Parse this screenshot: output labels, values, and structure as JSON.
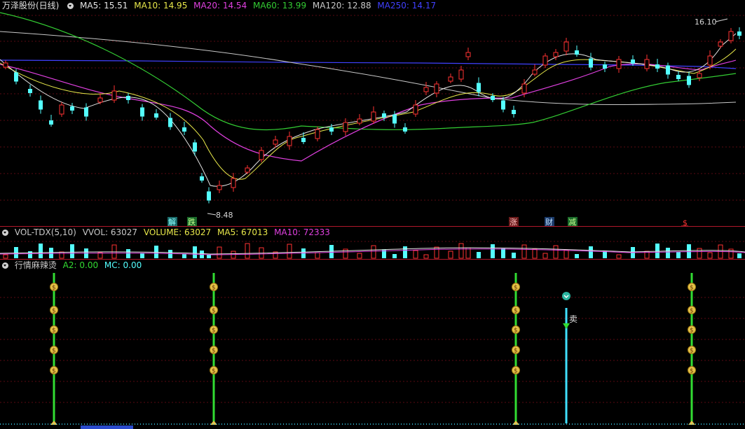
{
  "main": {
    "stock_name": "万泽股份(日线)",
    "ma": [
      {
        "label": "MA5: 15.51",
        "color": "#e6e6e6"
      },
      {
        "label": "MA10: 14.95",
        "color": "#e8e84a"
      },
      {
        "label": "MA20: 14.54",
        "color": "#e040e0"
      },
      {
        "label": "MA60: 13.99",
        "color": "#33cc33"
      },
      {
        "label": "MA120: 12.88",
        "color": "#c8c8c8"
      },
      {
        "label": "MA250: 14.17",
        "color": "#4040ff"
      }
    ],
    "high_label": "16.10",
    "low_label": "8.48",
    "events": [
      "解",
      "跌",
      "涨",
      "财",
      "减",
      "$"
    ]
  },
  "volume": {
    "title": "VOL-TDX(5,10)",
    "vvol": "VVOL: 63027",
    "volume": "VOLUME: 63027",
    "ma5": "MA5: 67013",
    "ma10": "MA10: 72333"
  },
  "indicator": {
    "title": "行情麻辣烫",
    "a2": "A2: 0.00",
    "mc": "MC: 0.00",
    "sell_label": "卖"
  },
  "colors": {
    "up": "#ff3232",
    "down": "#54ffff",
    "ma5": "#e6e6e6",
    "ma10": "#e8e84a",
    "ma20": "#e040e0",
    "ma60": "#33cc33",
    "ma120": "#c8c8c8",
    "ma250": "#4040ff",
    "green_line": "#32dc32",
    "cyan_line": "#40e0ff"
  }
}
